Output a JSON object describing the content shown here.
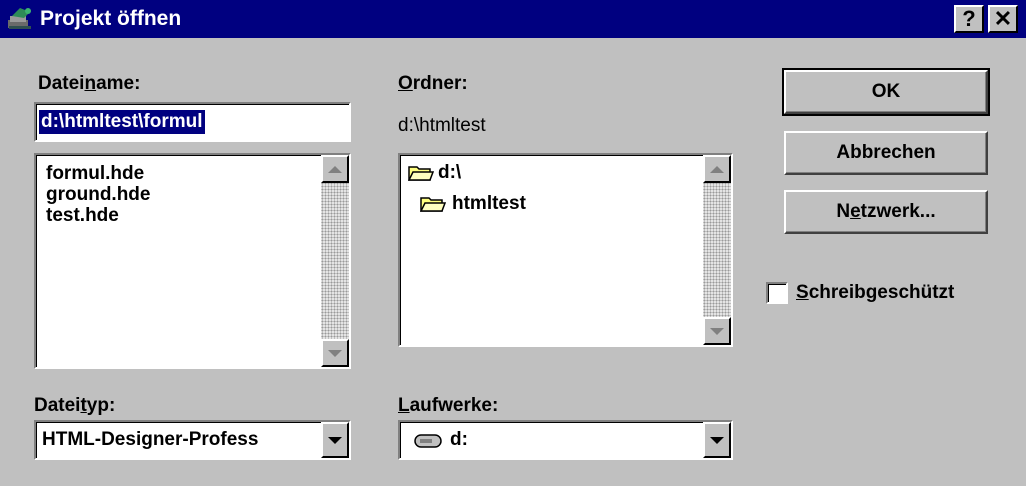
{
  "window": {
    "title": "Projekt öffnen",
    "help_label": "?",
    "close_label": "✕"
  },
  "filename": {
    "label_pre": "Datei",
    "label_key": "n",
    "label_post": "ame:",
    "value": "d:\\htmltest\\formul",
    "files": [
      "formul.hde",
      "ground.hde",
      "test.hde"
    ]
  },
  "folder": {
    "label_key": "O",
    "label_post": "rdner:",
    "path": "d:\\htmltest",
    "tree": [
      "d:\\",
      "htmltest"
    ]
  },
  "filetype": {
    "label_pre": "Datei",
    "label_key": "t",
    "label_post": "yp:",
    "selected": "HTML-Designer-Profess"
  },
  "drives": {
    "label_key": "L",
    "label_post": "aufwerke:",
    "selected": "d:"
  },
  "buttons": {
    "ok": "OK",
    "cancel": "Abbrechen",
    "network_pre": "N",
    "network_key": "e",
    "network_post": "tzwerk..."
  },
  "readonly": {
    "label_key": "S",
    "label_post": "chreibgeschützt",
    "checked": false
  },
  "colors": {
    "titlebar": "#000080",
    "dialog_bg": "#c0c0c0",
    "selection": "#000080",
    "folder": "#ffff80"
  }
}
